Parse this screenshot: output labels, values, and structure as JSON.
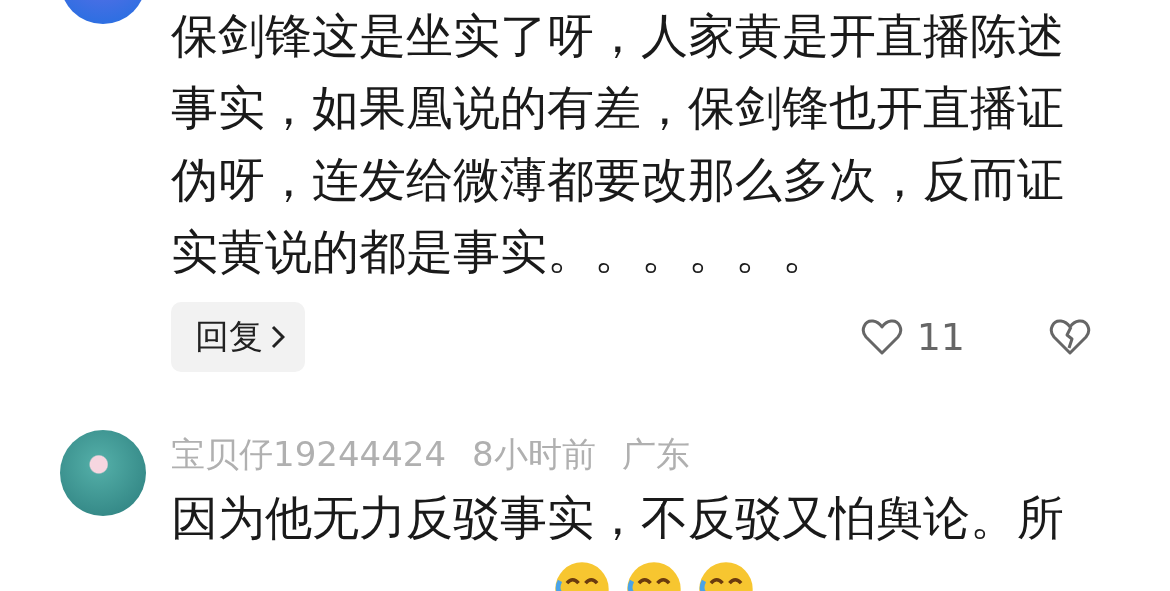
{
  "comments": [
    {
      "text": "保剑锋这是坐实了呀，人家黄是开直播陈述事实，如果凰说的有差，保剑锋也开直播证伪呀，连发给微薄都要改那么多次，反而证实黄说的都是事实。。。。。。",
      "reply": "回复",
      "likes": "11"
    },
    {
      "username": "宝贝仔19244424",
      "time": "8小时前",
      "location": "广东",
      "text": "因为他无力反驳事实，不反驳又怕舆论。所",
      "emojis": [
        {
          "kind": "laughing-crying"
        },
        {
          "kind": "laughing-crying"
        },
        {
          "kind": "laughing-crying"
        }
      ]
    }
  ]
}
